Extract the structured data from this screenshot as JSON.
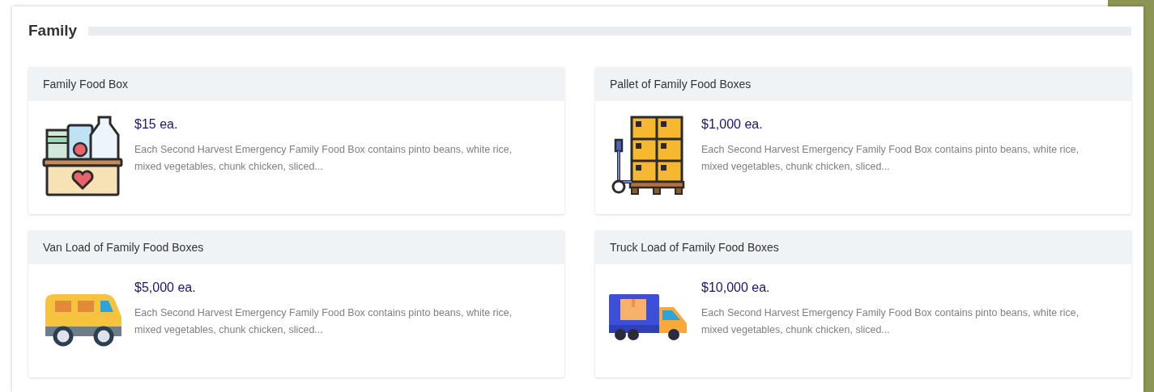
{
  "section": {
    "title": "Family"
  },
  "products": [
    {
      "name": "Family Food Box",
      "price": "$15 ea.",
      "description": "Each Second Harvest Emergency Family Food Box contains pinto beans, white rice, mixed vegetables, chunk chicken, sliced...",
      "kind": "box"
    },
    {
      "name": "Pallet of Family Food Boxes",
      "price": "$1,000 ea.",
      "description": "Each Second Harvest Emergency Family Food Box contains pinto beans, white rice, mixed vegetables, chunk chicken, sliced...",
      "kind": "pallet"
    },
    {
      "name": "Van Load of Family Food Boxes",
      "price": "$5,000 ea.",
      "description": "Each Second Harvest Emergency Family Food Box contains pinto beans, white rice, mixed vegetables, chunk chicken, sliced...",
      "kind": "van"
    },
    {
      "name": "Truck Load of Family Food Boxes",
      "price": "$10,000 ea.",
      "description": "Each Second Harvest Emergency Family Food Box contains pinto beans, white rice, mixed vegetables, chunk chicken, sliced...",
      "kind": "truck"
    }
  ]
}
